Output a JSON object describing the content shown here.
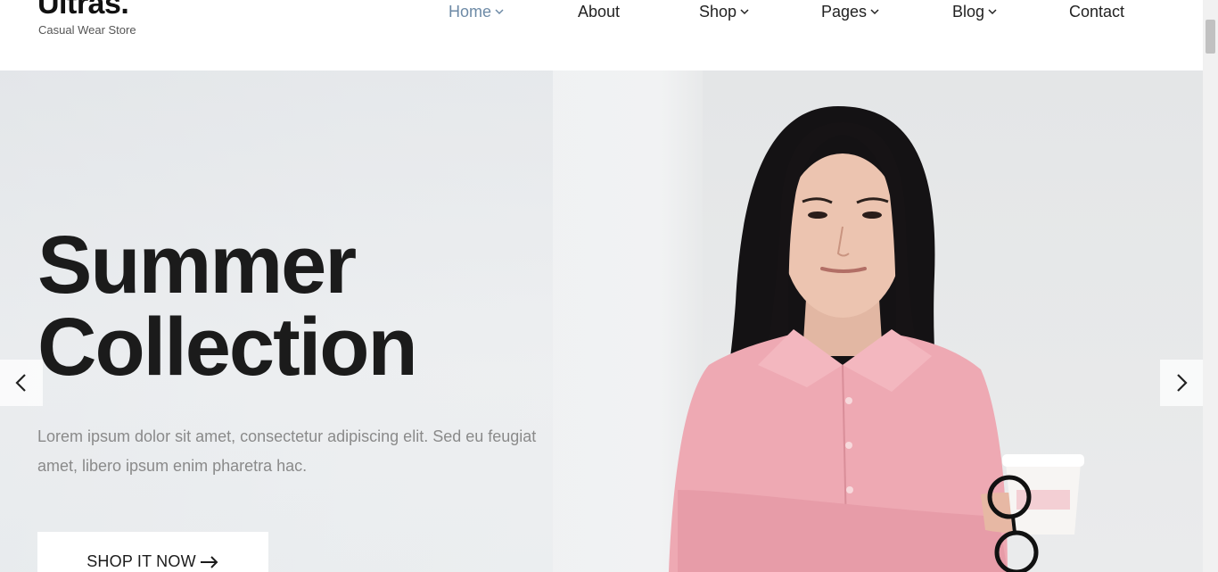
{
  "brand": {
    "name": "Ultras.",
    "tagline": "Casual Wear Store"
  },
  "nav": {
    "items": [
      {
        "label": "Home",
        "has_dropdown": true,
        "active": true
      },
      {
        "label": "About",
        "has_dropdown": false,
        "active": false
      },
      {
        "label": "Shop",
        "has_dropdown": true,
        "active": false
      },
      {
        "label": "Pages",
        "has_dropdown": true,
        "active": false
      },
      {
        "label": "Blog",
        "has_dropdown": true,
        "active": false
      },
      {
        "label": "Contact",
        "has_dropdown": false,
        "active": false
      }
    ],
    "active_color": "#6d8aa6"
  },
  "hero": {
    "title_line1": "Summer",
    "title_line2": "Collection",
    "description": "Lorem ipsum dolor sit amet, consectetur adipiscing elit. Sed eu feugiat amet, libero ipsum enim pharetra hac.",
    "cta_label": "SHOP IT NOW",
    "cta_icon": "arrow-right-icon",
    "prev_icon": "chevron-left-icon",
    "next_icon": "chevron-right-icon",
    "image": "woman-in-pink-shirt-holding-cup-and-glasses"
  }
}
